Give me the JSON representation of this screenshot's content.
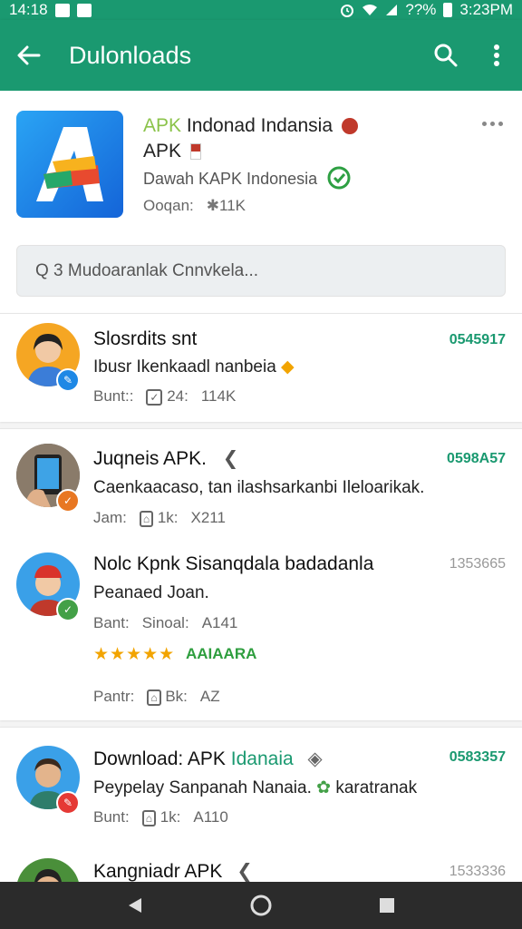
{
  "status_bar": {
    "time": "14:18",
    "battery_percent": "??%",
    "clock_right": "3:23PM"
  },
  "app_bar": {
    "title": "Dulonloads",
    "back_icon": "arrow-back-icon",
    "search_icon": "search-icon",
    "menu_icon": "more-vert-icon"
  },
  "header": {
    "title_accent": "APK",
    "title_rest": " Indonad Indansia",
    "title_line2": "APK",
    "subtitle": "Dawah KAPK Indonesia",
    "meta_label": "Ooqan:",
    "meta_value": "11K",
    "search_placeholder": "Q 3 Mudoaranlak Cnnvkela..."
  },
  "items": [
    {
      "title": "Slosrdits snt",
      "desc": "Ibusr Ikenkaadl nanbeia",
      "meta1": "Bunt::",
      "meta2": "24:",
      "meta3": "114K",
      "code": "0545917"
    },
    {
      "title": "Juqneis APK.",
      "desc": "Caenkaacaso, tan ilashsarkanbi Ileloarikak.",
      "meta1": "Jam:",
      "meta2": "1k:",
      "meta3": "X211",
      "code": "0598A57"
    },
    {
      "title": "Nolc Kpnk Sisanqdala badadanla",
      "desc": "Peanaed Joan.",
      "meta1": "Bant:",
      "meta2": "Sinoal:",
      "meta3": "A141",
      "stars": "★★★★★",
      "rating": "AAIAARA",
      "meta_b1": "Pantr:",
      "meta_b2": "Bk:",
      "meta_b3": "AZ",
      "code": "1353665"
    },
    {
      "title": "Download: APK",
      "title_accent": " Idanaia",
      "desc": "Peypelay Sanpanah Nanaia.",
      "desc2": " karatranak",
      "meta1": "Bunt:",
      "meta2": "1k:",
      "meta3": "A110",
      "code": "0583357"
    },
    {
      "title": "Kangniadr APK",
      "code": "1533336"
    }
  ],
  "colors": {
    "primary": "#1a9970",
    "accent_green": "#8bc34a",
    "navbar": "#2b2b2b"
  }
}
